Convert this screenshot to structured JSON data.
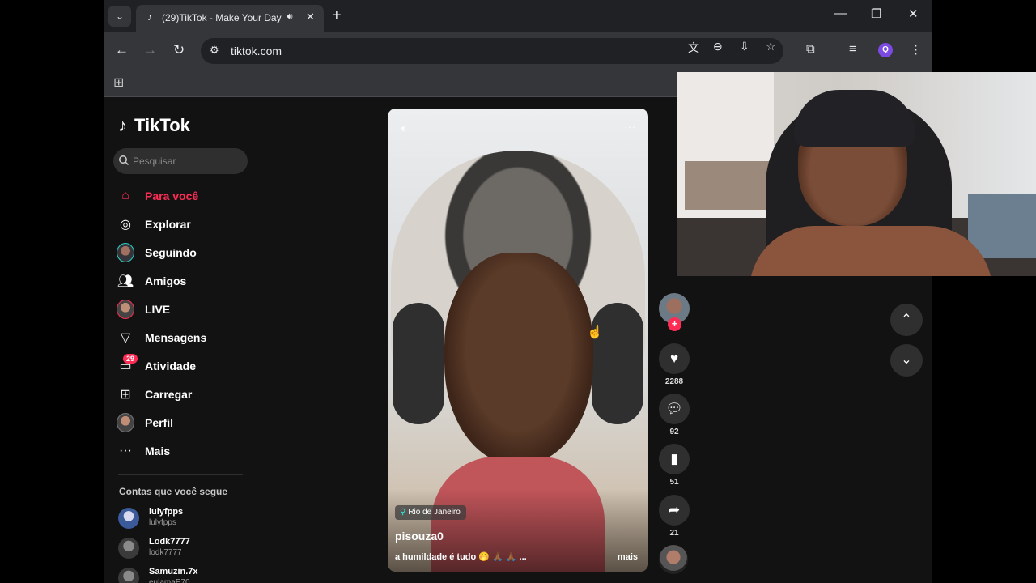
{
  "browser": {
    "tab_title": "(29)TikTok - Make Your Day",
    "url": "tiktok.com",
    "profile_initial": "Q"
  },
  "tiktok": {
    "logo": "TikTok",
    "search_placeholder": "Pesquisar",
    "nav": [
      {
        "label": "Para você",
        "icon": "home-icon",
        "active": true
      },
      {
        "label": "Explorar",
        "icon": "compass-icon"
      },
      {
        "label": "Seguindo",
        "icon": "following-avatar"
      },
      {
        "label": "Amigos",
        "icon": "friends-icon"
      },
      {
        "label": "LIVE",
        "icon": "live-avatar"
      },
      {
        "label": "Mensagens",
        "icon": "send-icon"
      },
      {
        "label": "Atividade",
        "icon": "inbox-icon",
        "badge": "29"
      },
      {
        "label": "Carregar",
        "icon": "upload-icon"
      },
      {
        "label": "Perfil",
        "icon": "profile-avatar"
      },
      {
        "label": "Mais",
        "icon": "more-icon"
      }
    ],
    "following_title": "Contas que você segue",
    "accounts": [
      {
        "name": "lulyfpps",
        "handle": "lulyfpps"
      },
      {
        "name": "Lodk7777",
        "handle": "lodk7777"
      },
      {
        "name": "Samuzin.7x",
        "handle": "eulamaE70"
      }
    ]
  },
  "video": {
    "location": "Rio de Janeiro",
    "username": "pisouza0",
    "caption": "a humildade é tudo 🤭 🙏🏾 🙏🏾 ...",
    "more_label": "mais",
    "likes": "2288",
    "comments": "92",
    "saves": "51",
    "shares": "21"
  },
  "colors": {
    "accent": "#fe2c55",
    "page_bg": "#121212",
    "chrome": "#35363a"
  }
}
